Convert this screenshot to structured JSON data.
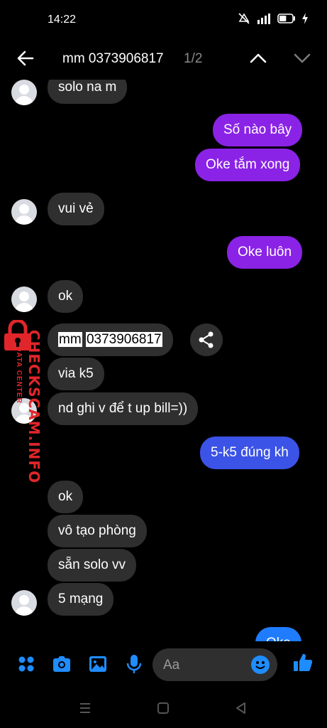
{
  "status": {
    "time": "14:22",
    "battery_level": 0.55
  },
  "header": {
    "search_text": "mm 0373906817",
    "match_count": "1/2"
  },
  "messages": {
    "m1": "solo na m",
    "m2": "Số nào bây",
    "m3": "Oke tắm xong",
    "m4": "vui vẻ",
    "m5": "Oke luôn",
    "m6": "ok",
    "m7_highlight_a": "mm",
    "m7_highlight_b": "0373906817",
    "m8": "via k5",
    "m9": "nd ghi v để t up bill=))",
    "m10": "5-k5 đúng kh",
    "m11": "ok",
    "m12": "vô tạo phòng",
    "m13": "sẵn solo vv",
    "m14": "5 mạng",
    "m15": "Oke"
  },
  "watermark": {
    "main": "CHECKSCAM.INFO",
    "sub": "DATA CENTER"
  },
  "composer": {
    "placeholder": "Aa"
  },
  "colors": {
    "outgoing": "#8a23e6",
    "outgoing_alt": "#3b53e6",
    "incoming": "#2f2f2f",
    "accent": "#1f8cff"
  }
}
